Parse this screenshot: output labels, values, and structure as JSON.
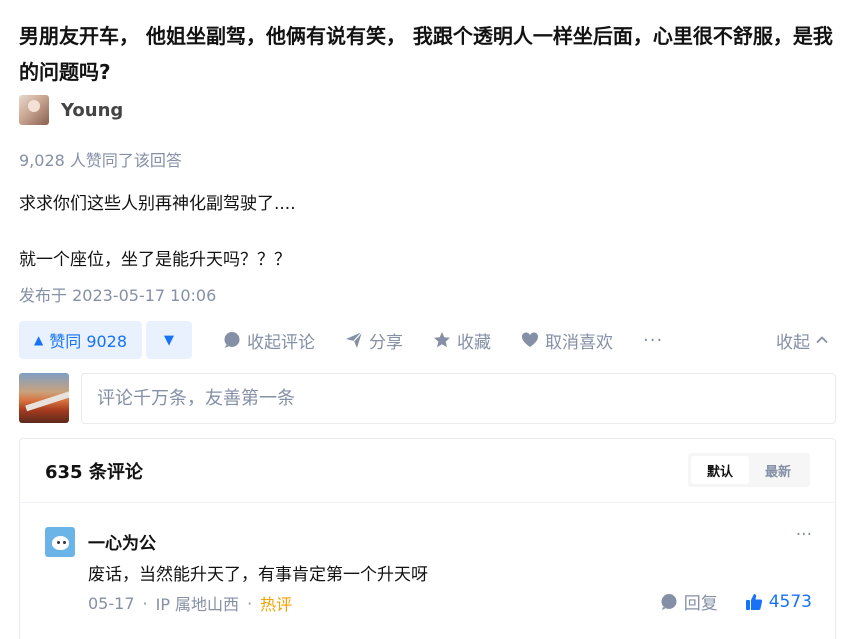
{
  "question": {
    "title": "男朋友开车， 他姐坐副驾，他俩有说有笑， 我跟个透明人一样坐后面，心里很不舒服，是我的问题吗?"
  },
  "author": {
    "name": "Young"
  },
  "answer": {
    "vote_meta": "9,028 人赞同了该回答",
    "content_lines": [
      "求求你们这些人别再神化副驾驶了....",
      "就一个座位，坐了是能升天吗？？？"
    ],
    "publish_time": "发布于 2023-05-17 10:06"
  },
  "actions": {
    "vote_up_label": "赞同 9028",
    "collapse_comments": "收起评论",
    "share": "分享",
    "favorite": "收藏",
    "unlike": "取消喜欢",
    "more": "···",
    "collapse": "收起"
  },
  "comment_input": {
    "placeholder": "评论千万条，友善第一条"
  },
  "comments_panel": {
    "count_label": "635 条评论",
    "sort_options": [
      "默认",
      "最新"
    ],
    "active_sort": "默认",
    "comments": [
      {
        "author": "一心为公",
        "text": "废话，当然能升天了，有事肯定第一个升天呀",
        "date": "05-17",
        "ip": "IP 属地山西",
        "tag": "热评",
        "reply_label": "回复",
        "likes": "4573"
      }
    ]
  },
  "colors": {
    "accent": "#1772f6",
    "accent_bg": "#e8f1fd",
    "muted": "#8590a6",
    "hot": "#f1a200"
  }
}
